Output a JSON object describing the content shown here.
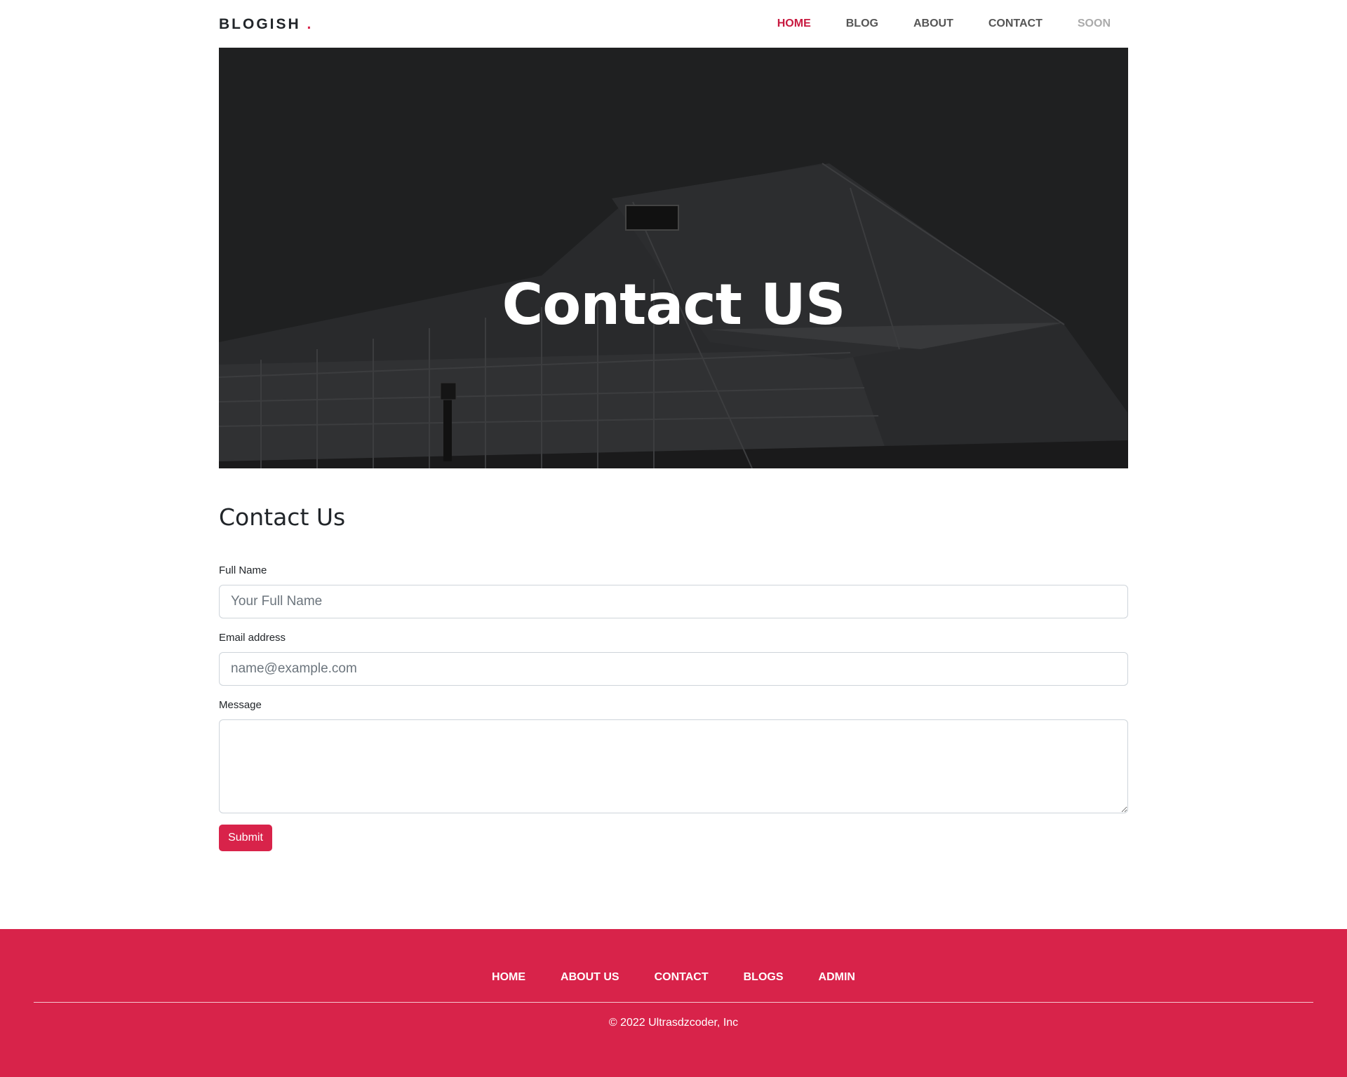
{
  "header": {
    "brand": "BLOGISH",
    "brand_dot": ".",
    "nav": [
      {
        "label": "HOME",
        "state": "active"
      },
      {
        "label": "BLOG",
        "state": "normal"
      },
      {
        "label": "ABOUT",
        "state": "normal"
      },
      {
        "label": "CONTACT",
        "state": "normal"
      },
      {
        "label": "SOON",
        "state": "disabled"
      }
    ]
  },
  "hero": {
    "title": "Contact US"
  },
  "form": {
    "title": "Contact Us",
    "full_name": {
      "label": "Full Name",
      "placeholder": "Your Full Name",
      "value": ""
    },
    "email": {
      "label": "Email address",
      "placeholder": "name@example.com",
      "value": ""
    },
    "message": {
      "label": "Message",
      "placeholder": "",
      "value": ""
    },
    "submit_label": "Submit"
  },
  "footer": {
    "links": [
      "HOME",
      "ABOUT US",
      "CONTACT",
      "BLOGS",
      "ADMIN"
    ],
    "copyright": "© 2022 Ultrasdzcoder, Inc"
  },
  "colors": {
    "accent": "#d8234a",
    "active_nav": "#c8193f",
    "hero_bg": "#1f1f20"
  }
}
